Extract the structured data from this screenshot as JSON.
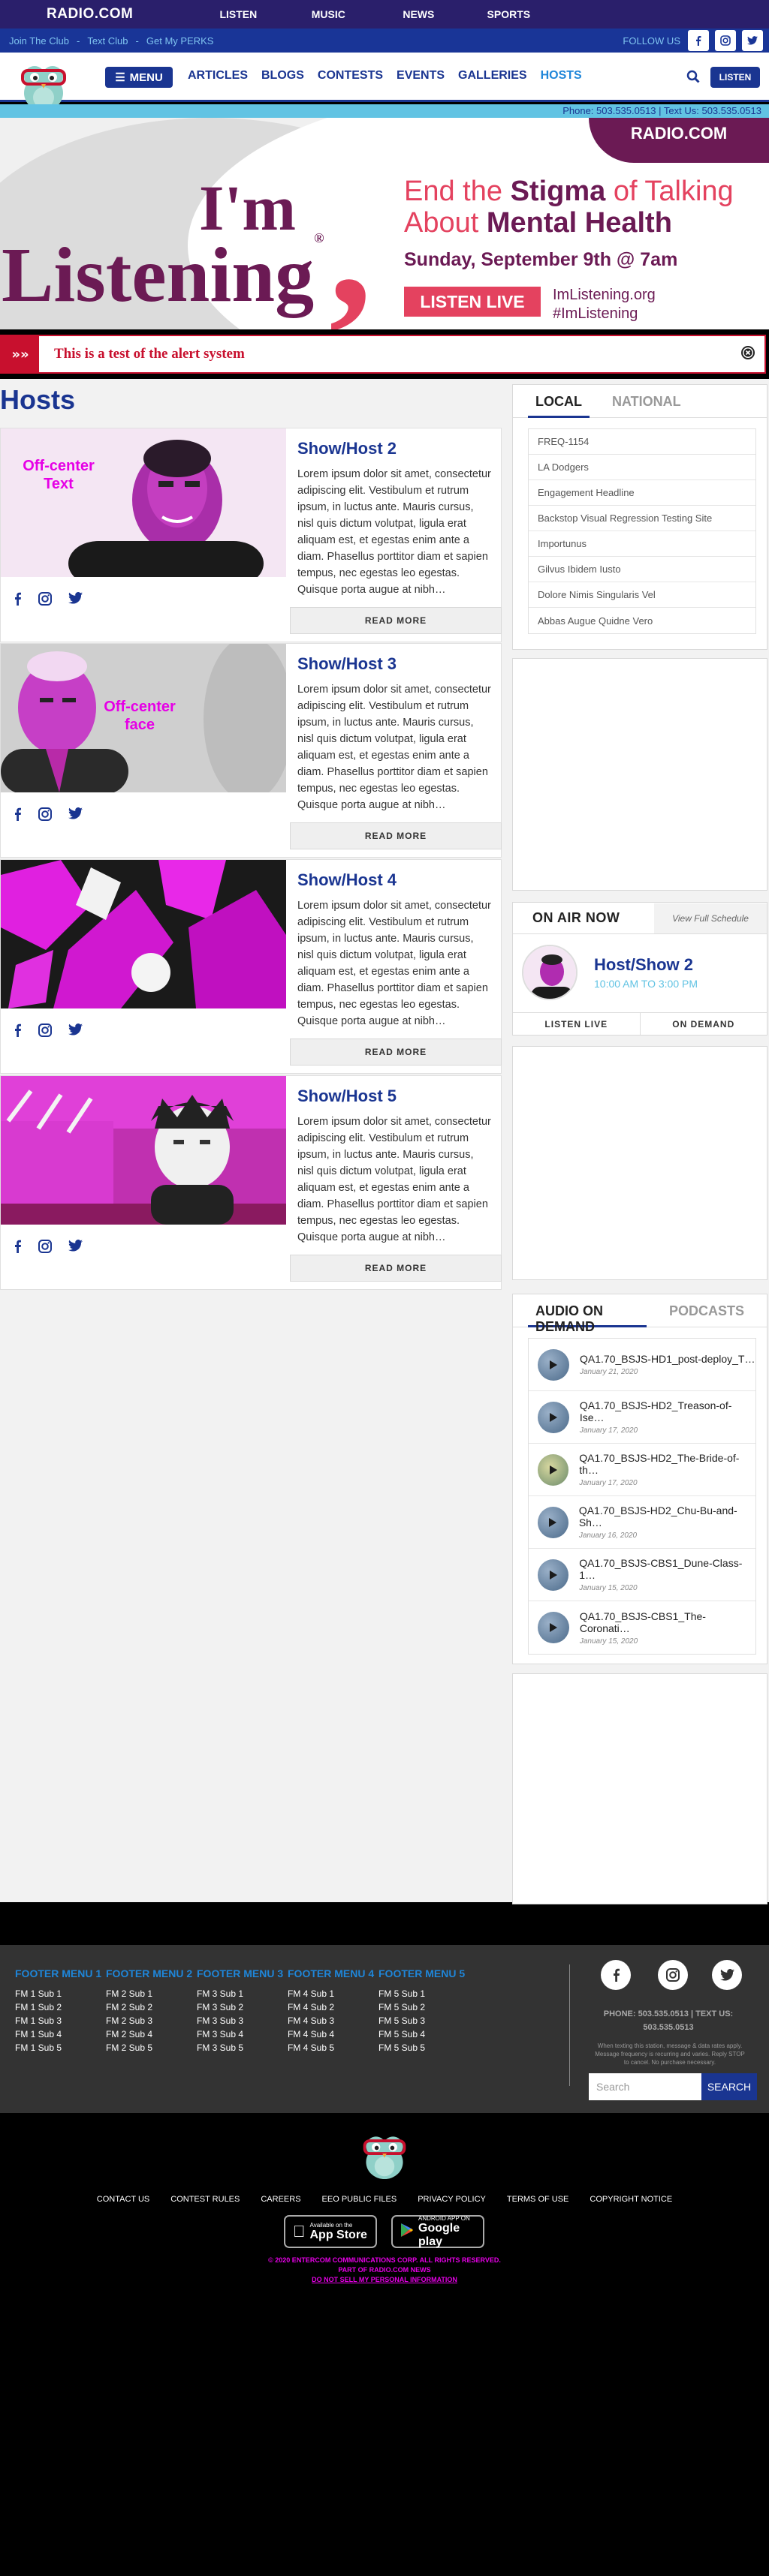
{
  "topbar": {
    "logo": "RADIO.COM",
    "nav": [
      "LISTEN",
      "MUSIC",
      "NEWS",
      "SPORTS"
    ]
  },
  "strip": {
    "links": [
      "Join The Club",
      "Text Club",
      "Get My PERKS"
    ],
    "follow": "FOLLOW US",
    "social": [
      "facebook-icon",
      "instagram-icon",
      "twitter-icon"
    ]
  },
  "nav": {
    "menu": "MENU",
    "links": [
      "ARTICLES",
      "BLOGS",
      "CONTESTS",
      "EVENTS",
      "GALLERIES",
      "HOSTS"
    ],
    "active": "HOSTS",
    "listen": "LISTEN"
  },
  "phonebar": "Phone: 503.535.0513 | Text Us: 503.535.0513",
  "hero": {
    "brand": "RADIO.COM",
    "im": "I'm",
    "listening": "Listening",
    "registered": "®",
    "line1a": "End the ",
    "line1b": "Stigma",
    "line1c": " of Talking",
    "line2a": "About ",
    "line2b": "Mental Health",
    "date": "Sunday, September 9th @ 7am",
    "button": "LISTEN LIVE",
    "site": "ImListening.org",
    "hashtag": "#ImListening",
    "colors": {
      "plum": "#6b1a54",
      "coral": "#e4425f"
    }
  },
  "alert": {
    "message": "This is a test of the alert system"
  },
  "hosts": {
    "title": "Hosts",
    "read_more": "READ MORE",
    "lorem": "Lorem ipsum dolor sit amet, consectetur adipiscing elit. Vestibulum et rutrum ipsum, in luctus ante. Mauris cursus, nisl quis dictum volutpat, ligula erat aliquam est, et egestas enim ante a diam. Phasellus porttitor diam et sapien tempus, nec egestas leo egestas. Quisque porta augue at nibh…",
    "cards": [
      {
        "title": "Show/Host 2",
        "overlay": "Off-center Text"
      },
      {
        "title": "Show/Host 3",
        "overlay": "Off-center face"
      },
      {
        "title": "Show/Host 4",
        "overlay": ""
      },
      {
        "title": "Show/Host 5",
        "overlay": ""
      }
    ]
  },
  "sidebar": {
    "local_tabs": [
      "LOCAL",
      "NATIONAL"
    ],
    "local_items": [
      "FREQ-1154",
      "LA Dodgers",
      "Engagement Headline",
      "Backstop Visual Regression Testing Site",
      "Importunus",
      "Gilvus Ibidem Iusto",
      "Dolore Nimis Singularis Vel",
      "Abbas Augue Quidne Vero"
    ],
    "onair": {
      "label": "ON AIR NOW",
      "full": "View Full Schedule",
      "show": "Host/Show 2",
      "time": "10:00 AM TO 3:00 PM",
      "listen": "LISTEN LIVE",
      "demand": "ON DEMAND"
    },
    "aod_tabs": [
      "AUDIO ON DEMAND",
      "PODCASTS"
    ],
    "aod_items": [
      {
        "title": "QA1.70_BSJS-HD1_post-deploy_T…",
        "date": "January 21, 2020"
      },
      {
        "title": "QA1.70_BSJS-HD2_Treason-of-Ise…",
        "date": "January 17, 2020"
      },
      {
        "title": "QA1.70_BSJS-HD2_The-Bride-of-th…",
        "date": "January 17, 2020"
      },
      {
        "title": "QA1.70_BSJS-HD2_Chu-Bu-and-Sh…",
        "date": "January 16, 2020"
      },
      {
        "title": "QA1.70_BSJS-CBS1_Dune-Class-1…",
        "date": "January 15, 2020"
      },
      {
        "title": "QA1.70_BSJS-CBS1_The-Coronati…",
        "date": "January 15, 2020"
      }
    ]
  },
  "footer": {
    "menus": [
      {
        "heading": "FOOTER MENU 1",
        "items": [
          "FM 1 Sub 1",
          "FM 1 Sub 2",
          "FM 1 Sub 3",
          "FM 1 Sub 4",
          "FM 1 Sub 5"
        ]
      },
      {
        "heading": "FOOTER MENU 2",
        "items": [
          "FM 2 Sub 1",
          "FM 2 Sub 2",
          "FM 2 Sub 3",
          "FM 2 Sub 4",
          "FM 2 Sub 5"
        ]
      },
      {
        "heading": "FOOTER MENU 3",
        "items": [
          "FM 3 Sub 1",
          "FM 3 Sub 2",
          "FM 3 Sub 3",
          "FM 3 Sub 4",
          "FM 3 Sub 5"
        ]
      },
      {
        "heading": "FOOTER MENU 4",
        "items": [
          "FM 4 Sub 1",
          "FM 4 Sub 2",
          "FM 4 Sub 3",
          "FM 4 Sub 4",
          "FM 4 Sub 5"
        ]
      },
      {
        "heading": "FOOTER MENU 5",
        "items": [
          "FM 5 Sub 1",
          "FM 5 Sub 2",
          "FM 5 Sub 3",
          "FM 5 Sub 4",
          "FM 5 Sub 5"
        ]
      }
    ],
    "phone1": "PHONE: 503.535.0513 | TEXT US:",
    "phone2": "503.535.0513",
    "note": "When texting this station, message & data rates apply. Message frequency is recurring and varies. Reply STOP to cancel. No purchase necessary.",
    "search_placeholder": "Search",
    "search_button": "SEARCH"
  },
  "bottom": {
    "links": [
      "CONTACT US",
      "CONTEST RULES",
      "CAREERS",
      "EEO PUBLIC FILES",
      "PRIVACY POLICY",
      "TERMS OF USE",
      "COPYRIGHT NOTICE"
    ],
    "appstore_small": "Available on the",
    "appstore_big": "App Store",
    "gplay_small": "ANDROID APP ON",
    "gplay_big": "Google play",
    "copyright": "© 2020 ENTERCOM COMMUNICATIONS CORP. ALL RIGHTS RESERVED.",
    "part_of": "PART OF RADIO.COM NEWS",
    "dns": "DO NOT SELL MY PERSONAL INFORMATION"
  }
}
